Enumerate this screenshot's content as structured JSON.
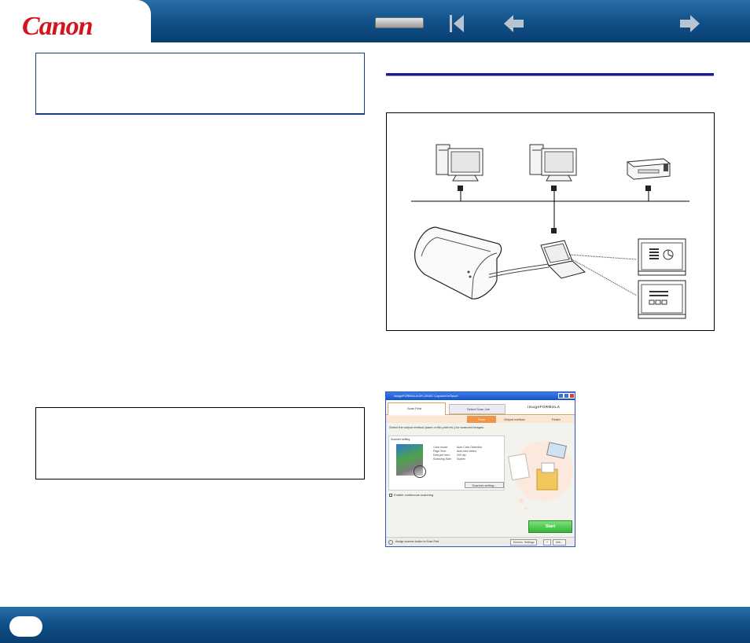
{
  "header": {
    "logo": "Canon",
    "nav": {
      "top_button": "",
      "first_page_icon": "first-page-icon",
      "prev_icon": "arrow-left-icon",
      "next_icon": "arrow-right-icon"
    }
  },
  "colors": {
    "header_blue": "#0f4e87",
    "brand_red": "#d4141c",
    "rule_blue": "#1a1a9a"
  },
  "scan_window": {
    "title": "imageFORMULA DR-2510C CaptureOnTouch",
    "tab_scan_first": "Scan First",
    "tab_select_scan_job": "Select Scan Job",
    "brand": "imageFORMULA",
    "steps": [
      "Scan",
      "Output method",
      "Finish"
    ],
    "instruction": "Select the output method (save or file print etc.) for scanned images",
    "panel_title": "Scanner setting",
    "settings": [
      {
        "label": "Color mode:",
        "value": "Auto Color Detection"
      },
      {
        "label": "Page Size:",
        "value": "Auto-size detect"
      },
      {
        "label": "Dots per inch:",
        "value": "200 dpi"
      },
      {
        "label": "Scanning Side:",
        "value": "Duplex"
      }
    ],
    "scanner_setting_button": "Scanner setting...",
    "continuous_checkbox": "Enable continuous scanning",
    "start_button": "Start",
    "status_text": "Assign scanner button to Scan First",
    "env_settings_button": "Environ. Settings",
    "help_button": "?",
    "info_button": "Info..."
  },
  "footer": {
    "page_number": ""
  }
}
